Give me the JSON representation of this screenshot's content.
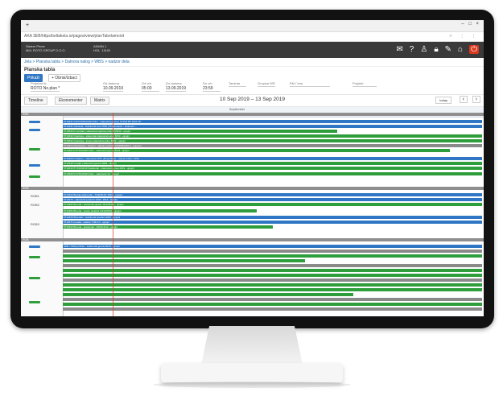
{
  "browser": {
    "tab_title": "+",
    "window_controls": "– □ ×",
    "url": "AKA 3EB/https/beltakela.io/pagea/view/planTabelamonit",
    "url_icons": "☆ ⋮ ⋮"
  },
  "app": {
    "brand_line1": "Sistem Prime",
    "brand_line2": "MM: ROTO GROUP D.O.O.",
    "user_line1": "ADMIN 1",
    "user_line2": "HOL. 13LIB"
  },
  "header_icons": [
    "mail-icon",
    "help-icon",
    "person-icon",
    "lock-icon",
    "wrench-icon",
    "home-icon",
    "power-icon"
  ],
  "breadcrumb": "Jela > Planska tabla > Dalnora nalog > WBS > nadzor dela",
  "filters": {
    "title": "Planska tabla",
    "btn_refresh": "Prikaži",
    "btn_clear": "+ Obrisi/Izbaci",
    "project_label": "Projekat lic",
    "project_value": "ROTO No.plan *",
    "from_date_label": "Od datuma",
    "from_date": "10.09.2019",
    "from_time_label": "Od vrh",
    "from_time": "05:00",
    "to_date_label": "Do datuma",
    "to_date": "13.09.2019",
    "to_time_label": "Do vrh",
    "to_time": "23:59",
    "status_label": "Taminta",
    "group_label": "Grupisa WR",
    "shift_label": "EM / Ima",
    "project2_label": "Projekti"
  },
  "toolbar": {
    "timeline": "Timeline",
    "resources": "Ekonomenter",
    "matrix": "Matrix",
    "range": "10 Sep 2019 – 13 Sep 2019",
    "today": "today",
    "prev": "‹",
    "next": "›"
  },
  "timeline": {
    "month_label": "September",
    "ticks": [
      "10",
      "11",
      "12",
      "13"
    ]
  },
  "sections": [
    {
      "label": "RIB1"
    },
    {
      "label": "ROB"
    },
    {
      "label": "ROB"
    }
  ],
  "lanes": [
    "ZEMA1",
    "ZEMA2",
    "ZEMA3",
    "ZEMA4",
    "ZEMA5",
    "ROB1",
    "ROB2",
    "ROB3",
    "ROB4",
    "ROB5",
    "ROB6"
  ],
  "bars": [
    "5710431 R 8471004/2019-Inline - statutorial gonoa | 5710/2 BT 2021 45...",
    "5710431 Glosasta - statutorial stud 7009 | Prejamtoniin - statimeni ...",
    "5710540 R sondala | statutorial naplova prilaz 8/28/19 - ujnejni",
    "5710432 Grastreta - statutorial statutorial-natun 8/4/3 - ujnejni",
    "5710543 Grastreta - Jovan statutorial natun 8/4/3 - ujnejni",
    "5710524 Mandartam - Solemi - statute prednici 1002/899/2019 - (ujnejni)",
    "5710402 R 9710/2019 Inline - statutorial gonoa 8/4/3 - ujnejni",
    "5710408 Omaleno - statutorial 1071 | Bosenfeser - statute 1002 / 2019",
    "5710439 Ismajla | statutorial gonoa 2884 - ujnejni",
    "5710433 B 7100/2019 Statutorial - statutorial gonoa 2019 - ujnejni",
    "5710400 R 3710/2019 Inline - statutorial 10 - ujnejni",
    "5710403 Brebija statutorial - 7100/2019 / 8/4/3 - ujnejni",
    "5710476 - statutorial prednici 1002 / 2019 - statute",
    "5710483 Brenda - statutorial pjesak 10/12/9101 - ujnejni",
    "5710484 Brenda - Jovan prekidni 10/12/2019 - ujnejni",
    "5710465 Bramalin - statutorial prednici 2019 - ujnejni",
    "5710471 Ismaila - statute 7100 10 - ujnejni",
    "5710493 Brenda - statutorial - 2019/10/12 - ujnejni",
    "3481 / 9010 priticko - statutorial gonoa 2019 - ujnejni"
  ]
}
